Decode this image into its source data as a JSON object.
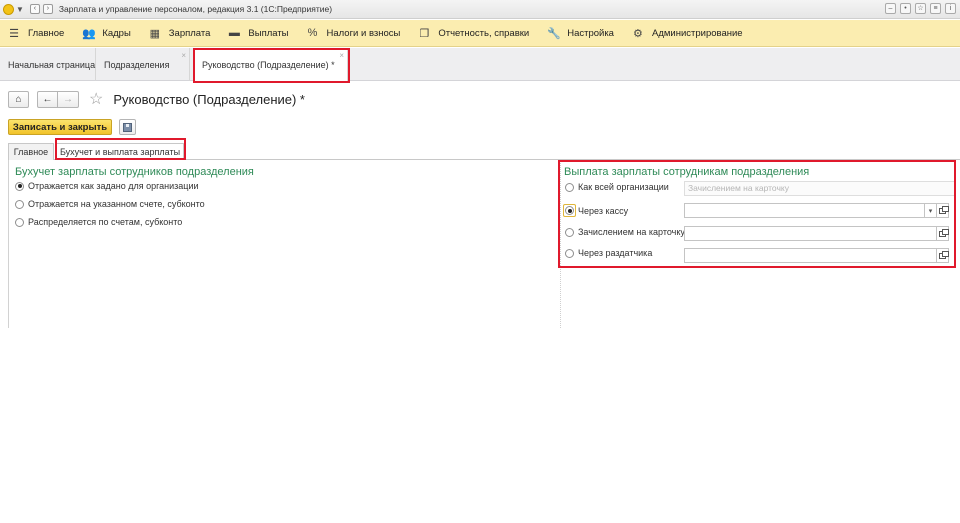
{
  "window": {
    "title": "Зарплата и управление персоналом, редакция 3.1  (1С:Предприятие)"
  },
  "main_menu": [
    {
      "label": "Главное",
      "icon": "menu-lines-icon"
    },
    {
      "label": "Кадры",
      "icon": "people-icon"
    },
    {
      "label": "Зарплата",
      "icon": "calculator-icon"
    },
    {
      "label": "Выплаты",
      "icon": "money-icon"
    },
    {
      "label": "Налоги и взносы",
      "icon": "percent-icon"
    },
    {
      "label": "Отчетность, справки",
      "icon": "documents-icon"
    },
    {
      "label": "Настройка",
      "icon": "wrench-icon"
    },
    {
      "label": "Администрирование",
      "icon": "gear-icon"
    }
  ],
  "section_tabs": [
    {
      "label": "Начальная страница"
    },
    {
      "label": "Подразделения"
    },
    {
      "label": "Руководство (Подразделение) *"
    }
  ],
  "form": {
    "title": "Руководство (Подразделение) *",
    "save_close_label": "Записать и закрыть",
    "tabs": [
      {
        "label": "Главное"
      },
      {
        "label": "Бухучет и выплата зарплаты"
      }
    ]
  },
  "accounting_group": {
    "title": "Бухучет зарплаты сотрудников подразделения",
    "options": [
      {
        "label": "Отражается как задано для организации",
        "selected": true
      },
      {
        "label": "Отражается на указанном счете, субконто",
        "selected": false
      },
      {
        "label": "Распределяется по счетам, субконто",
        "selected": false
      }
    ]
  },
  "payment_group": {
    "title": "Выплата зарплаты сотрудникам подразделения",
    "options": [
      {
        "label": "Как всей организации",
        "selected": false,
        "field_value": "Зачислением на карточку"
      },
      {
        "label": "Через кассу",
        "selected": true,
        "field_value": ""
      },
      {
        "label": "Зачислением на карточку",
        "selected": false,
        "field_value": ""
      },
      {
        "label": "Через раздатчика",
        "selected": false,
        "field_value": ""
      }
    ]
  },
  "colors": {
    "menu_bar": "#fbedb0",
    "group_title": "#2e8a57",
    "primary_button": "#f1c32a",
    "highlight_frame": "#e0192c"
  }
}
